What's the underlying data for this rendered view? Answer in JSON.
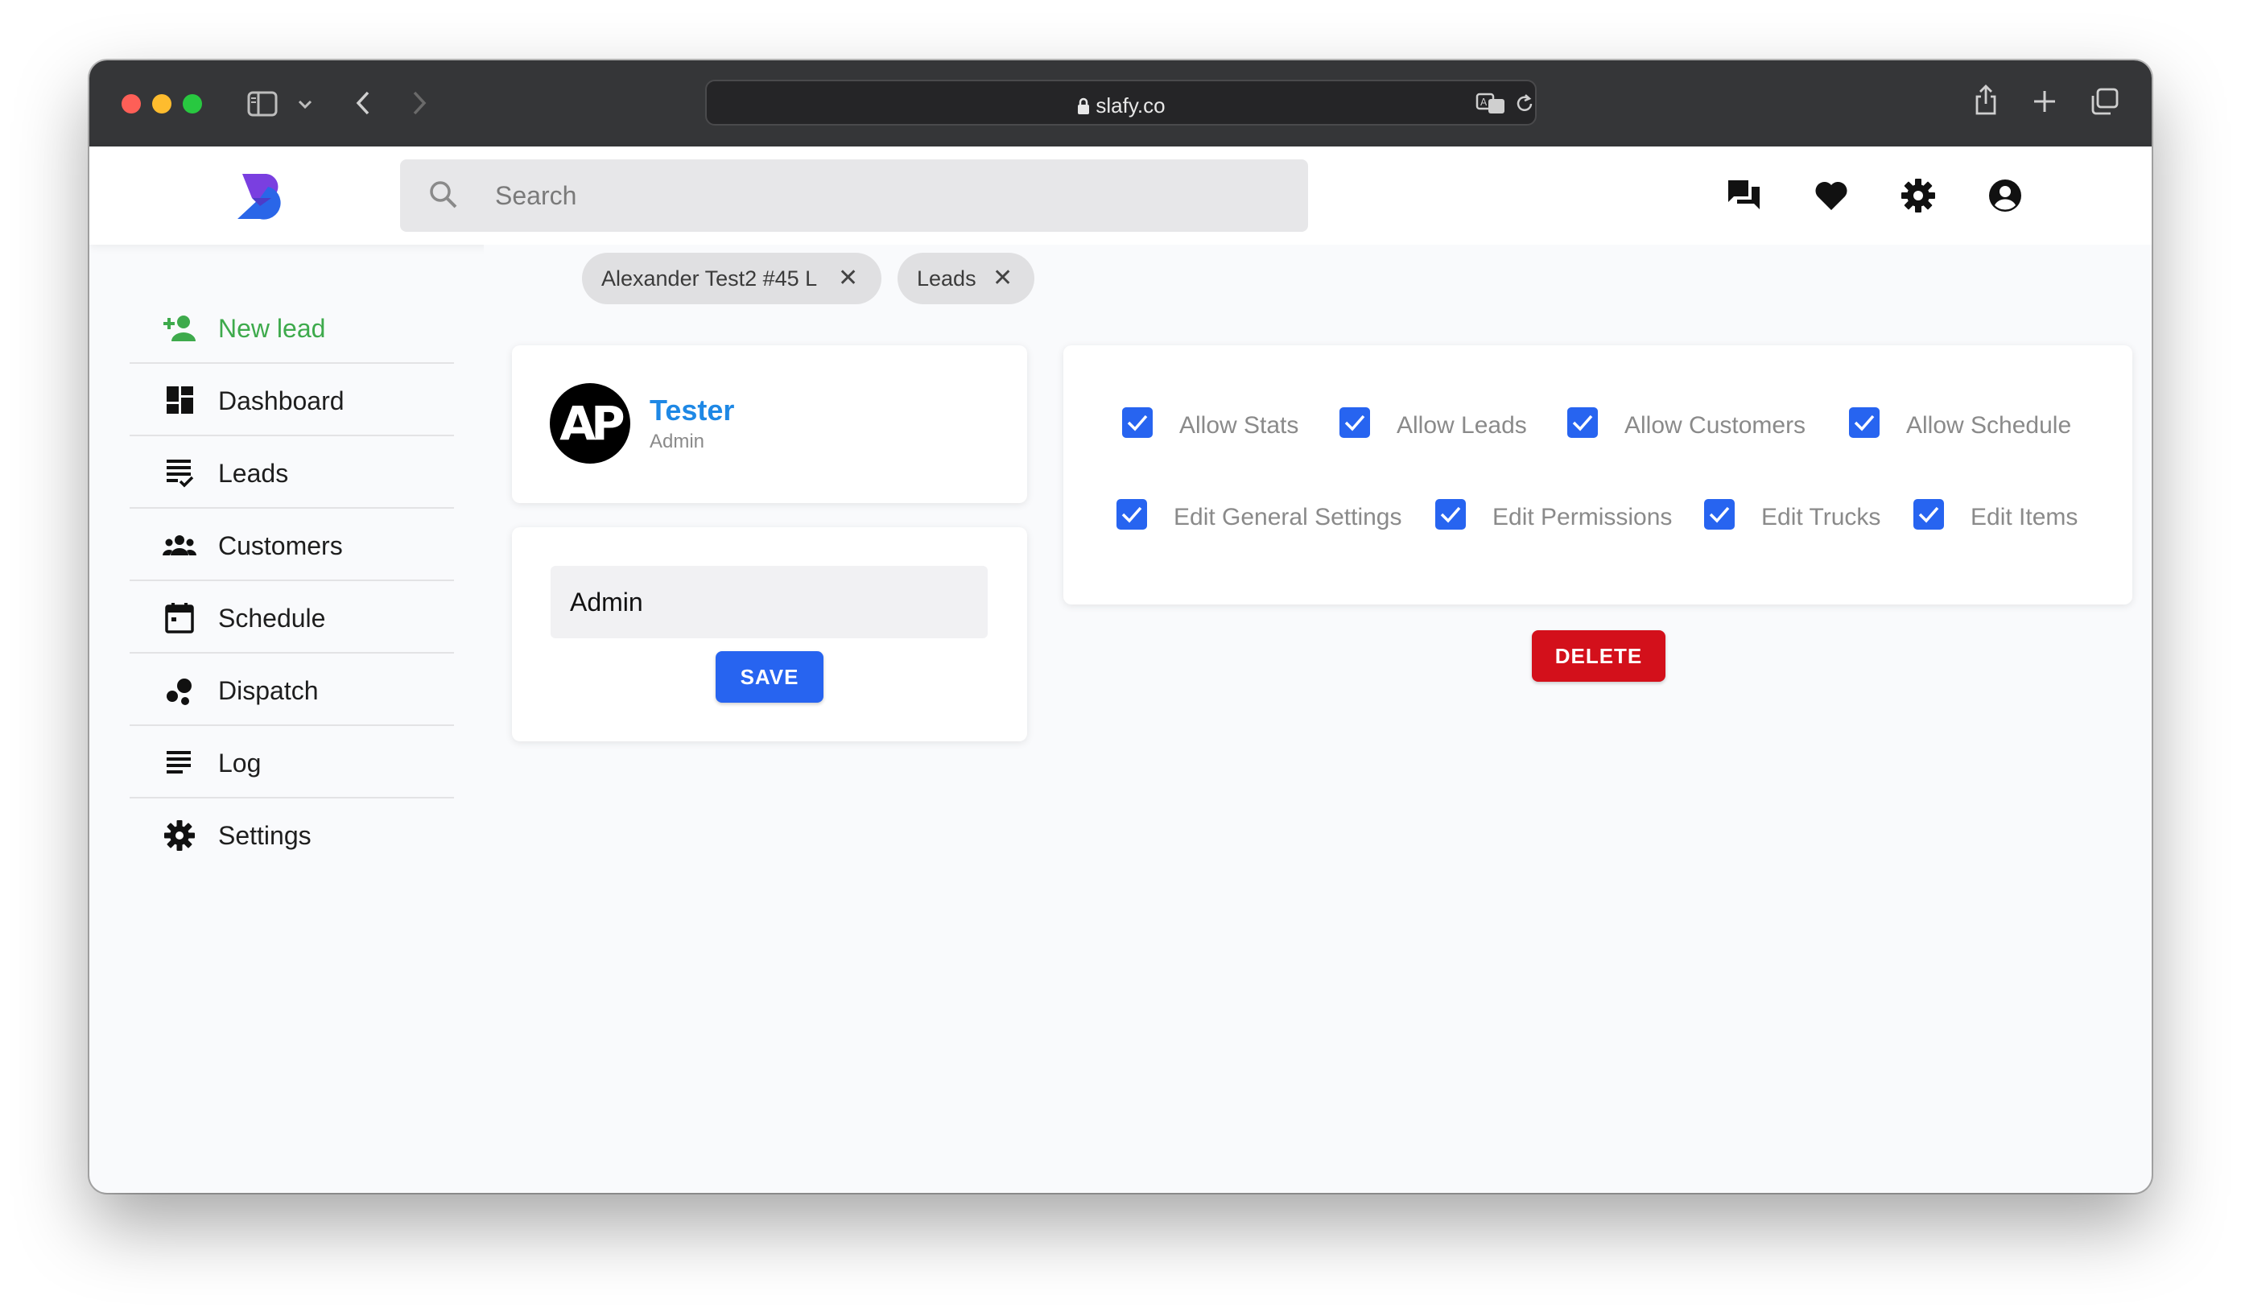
{
  "browser": {
    "url": "slafy.co"
  },
  "header": {
    "search_placeholder": "Search",
    "icons": [
      "chat-icon",
      "heart-icon",
      "gear-icon",
      "account-icon"
    ]
  },
  "tabs": [
    {
      "label": "Alexander Test2 #45 L"
    },
    {
      "label": "Leads"
    }
  ],
  "sidebar": {
    "items": [
      {
        "label": "New lead",
        "icon": "person-add-icon",
        "color": "#3eaa4c"
      },
      {
        "label": "Dashboard",
        "icon": "dashboard-icon"
      },
      {
        "label": "Leads",
        "icon": "checklist-icon"
      },
      {
        "label": "Customers",
        "icon": "people-icon"
      },
      {
        "label": "Schedule",
        "icon": "calendar-icon"
      },
      {
        "label": "Dispatch",
        "icon": "bubbles-icon"
      },
      {
        "label": "Log",
        "icon": "lines-icon"
      },
      {
        "label": "Settings",
        "icon": "gear-icon"
      }
    ]
  },
  "user": {
    "initials": "AP",
    "name": "Tester",
    "role": "Admin"
  },
  "role_form": {
    "value": "Admin",
    "save_label": "SAVE"
  },
  "permissions": [
    {
      "label": "Allow Stats",
      "checked": true
    },
    {
      "label": "Allow Leads",
      "checked": true
    },
    {
      "label": "Allow Customers",
      "checked": true
    },
    {
      "label": "Allow Schedule",
      "checked": true
    },
    {
      "label": "Edit General Settings",
      "checked": true
    },
    {
      "label": "Edit Permissions",
      "checked": true
    },
    {
      "label": "Edit Trucks",
      "checked": true
    },
    {
      "label": "Edit Items",
      "checked": true
    }
  ],
  "delete_label": "DELETE",
  "colors": {
    "primary": "#2764f0",
    "danger": "#d3101b",
    "accent_name": "#1e88e5",
    "new_lead": "#3eaa4c"
  }
}
